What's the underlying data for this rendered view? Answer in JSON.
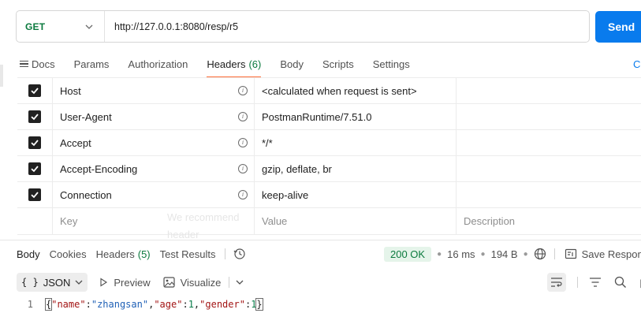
{
  "request": {
    "method": "GET",
    "url": "http://127.0.0.1:8080/resp/r5",
    "send_label": "Send"
  },
  "request_tabs": [
    {
      "label": "Docs",
      "count": ""
    },
    {
      "label": "Params",
      "count": ""
    },
    {
      "label": "Authorization",
      "count": ""
    },
    {
      "label": "Headers",
      "count": "(6)"
    },
    {
      "label": "Body",
      "count": ""
    },
    {
      "label": "Scripts",
      "count": ""
    },
    {
      "label": "Settings",
      "count": ""
    }
  ],
  "cookies_label": "C",
  "headers": [
    {
      "key": "Host",
      "value": "<calculated when request is sent>",
      "description": ""
    },
    {
      "key": "User-Agent",
      "value": "PostmanRuntime/7.51.0",
      "description": ""
    },
    {
      "key": "Accept",
      "value": "*/*",
      "description": ""
    },
    {
      "key": "Accept-Encoding",
      "value": "gzip, deflate, br",
      "description": ""
    },
    {
      "key": "Connection",
      "value": "keep-alive",
      "description": ""
    }
  ],
  "new_header_placeholders": {
    "key": "Key",
    "value": "Value",
    "description": "Description"
  },
  "ghost_text": {
    "line1": "We recommend",
    "line2": "header"
  },
  "response_tabs": [
    {
      "label": "Body",
      "count": ""
    },
    {
      "label": "Cookies",
      "count": ""
    },
    {
      "label": "Headers",
      "count": "(5)"
    },
    {
      "label": "Test Results",
      "count": ""
    }
  ],
  "response_meta": {
    "status": "200 OK",
    "time": "16 ms",
    "size": "194 B",
    "save_label": "Save Respons"
  },
  "response_tools": {
    "format": "JSON",
    "preview": "Preview",
    "visualize": "Visualize"
  },
  "response_body": {
    "line_number": "1",
    "json": {
      "name": "zhangsan",
      "age": "1",
      "gender": "1"
    }
  },
  "colors": {
    "accent": "#ff6c37",
    "send": "#097bed",
    "method_get": "#0b7a3e",
    "status_ok": "#0b7a3e"
  },
  "icons": [
    "chevron-down-icon",
    "docs-icon",
    "checkbox-checked-icon",
    "info-icon",
    "history-icon",
    "globe-icon",
    "save-icon",
    "play-icon",
    "image-icon",
    "wrap-lines-icon",
    "filter-icon",
    "search-icon",
    "copy-icon"
  ]
}
